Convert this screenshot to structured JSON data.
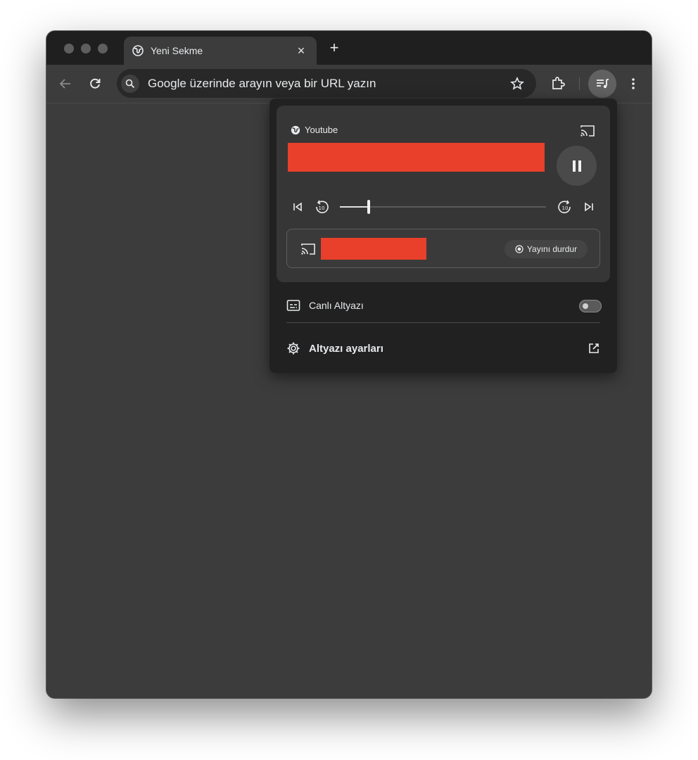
{
  "tab": {
    "title": "Yeni Sekme",
    "close_glyph": "×",
    "favicon": "globe-icon"
  },
  "new_tab": {
    "glyph": "+"
  },
  "omnibox": {
    "placeholder": "Google üzerinde arayın veya bir URL yazın"
  },
  "media": {
    "source": "Youtube",
    "progress_fraction": 0.14,
    "stop_label": "Yayını durdur",
    "title_redacted_color": "#e8402a"
  },
  "captions": {
    "live_label": "Canlı Altyazı",
    "live_enabled": false,
    "settings_label": "Altyazı ayarları"
  },
  "colors": {
    "window_bg": "#3c3c3c",
    "titlebar_bg": "#1f1f1f",
    "popup_bg": "#212121",
    "card_bg": "#363636",
    "redact": "#e8402a",
    "text": "#e8eaed"
  }
}
